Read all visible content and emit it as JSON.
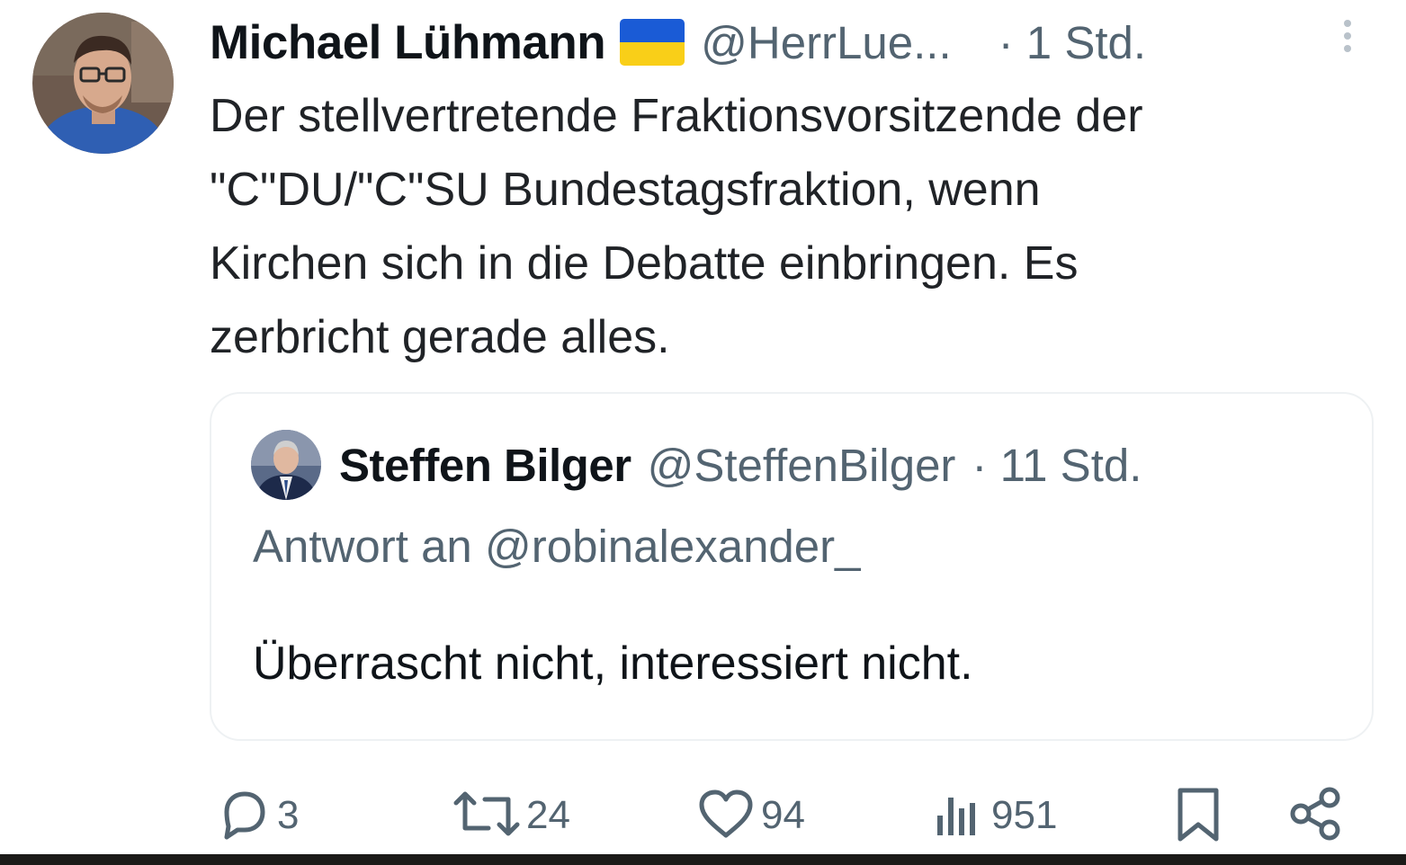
{
  "tweet": {
    "author_name": "Michael Lühmann",
    "flag_icon": "ukraine-flag-icon",
    "handle": "@HerrLue...",
    "time": "· 1 Std.",
    "text": "Der stellvertretende Fraktionsvorsitzende der\n\"C\"DU/\"C\"SU Bundestagsfraktion, wenn\nKirchen sich in die Debatte einbringen. Es\nzerbricht gerade alles."
  },
  "quote": {
    "author_name": "Steffen Bilger",
    "handle": "@SteffenBilger",
    "time": "· 11 Std.",
    "reply_to": "Antwort an @robinalexander_",
    "text": "Überrascht nicht, interessiert nicht."
  },
  "actions": {
    "replies": "3",
    "reposts": "24",
    "likes": "94",
    "views": "951"
  },
  "colors": {
    "text_primary": "#0f1419",
    "text_secondary": "#536471",
    "border": "#eef1f3",
    "flag_blue": "#1a5bd6",
    "flag_yellow": "#f9cf18"
  }
}
